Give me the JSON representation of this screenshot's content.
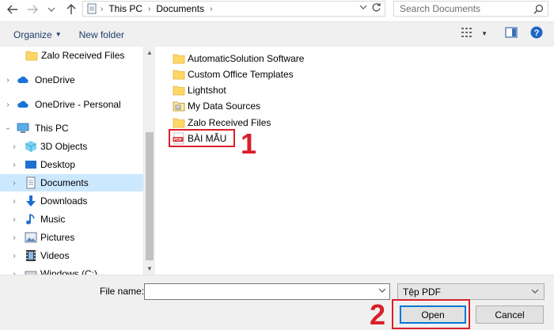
{
  "window": {
    "path": [
      "This PC",
      "Documents"
    ]
  },
  "search": {
    "placeholder": "Search Documents"
  },
  "toolbar": {
    "organize_label": "Organize",
    "new_folder_label": "New folder"
  },
  "navigation": {
    "items": [
      {
        "label": "Zalo Received Files",
        "icon": "folder-icon"
      },
      {
        "label": "OneDrive",
        "icon": "cloud-icon"
      },
      {
        "label": "OneDrive - Personal",
        "icon": "cloud-icon"
      },
      {
        "label": "This PC",
        "icon": "computer-icon"
      },
      {
        "label": "3D Objects",
        "icon": "cube-icon"
      },
      {
        "label": "Desktop",
        "icon": "desktop-icon"
      },
      {
        "label": "Documents",
        "icon": "document-icon"
      },
      {
        "label": "Downloads",
        "icon": "download-arrow-icon"
      },
      {
        "label": "Music",
        "icon": "music-note-icon"
      },
      {
        "label": "Pictures",
        "icon": "picture-icon"
      },
      {
        "label": "Videos",
        "icon": "film-icon"
      },
      {
        "label": "Windows (C:)",
        "icon": "drive-icon"
      }
    ],
    "selected": "Documents"
  },
  "files": [
    {
      "name": "AutomaticSolution Software",
      "icon": "folder-icon"
    },
    {
      "name": "Custom Office Templates",
      "icon": "folder-icon"
    },
    {
      "name": "Lightshot",
      "icon": "folder-icon"
    },
    {
      "name": "My Data Sources",
      "icon": "data-folder-icon"
    },
    {
      "name": "Zalo Received Files",
      "icon": "folder-icon"
    },
    {
      "name": "BÀI MẪU",
      "icon": "pdf-icon",
      "pdf_badge": "PDF"
    }
  ],
  "bottom": {
    "file_name_label": "File name:",
    "file_name_value": "",
    "file_type": "Tệp PDF",
    "open_label": "Open",
    "cancel_label": "Cancel"
  },
  "annotations": {
    "step1": "1",
    "step2": "2"
  },
  "colors": {
    "annotation_red": "#d9202a",
    "selection_blue": "#cce8ff",
    "accent_blue": "#0078d7",
    "folder_yellow": "#ffd766"
  }
}
